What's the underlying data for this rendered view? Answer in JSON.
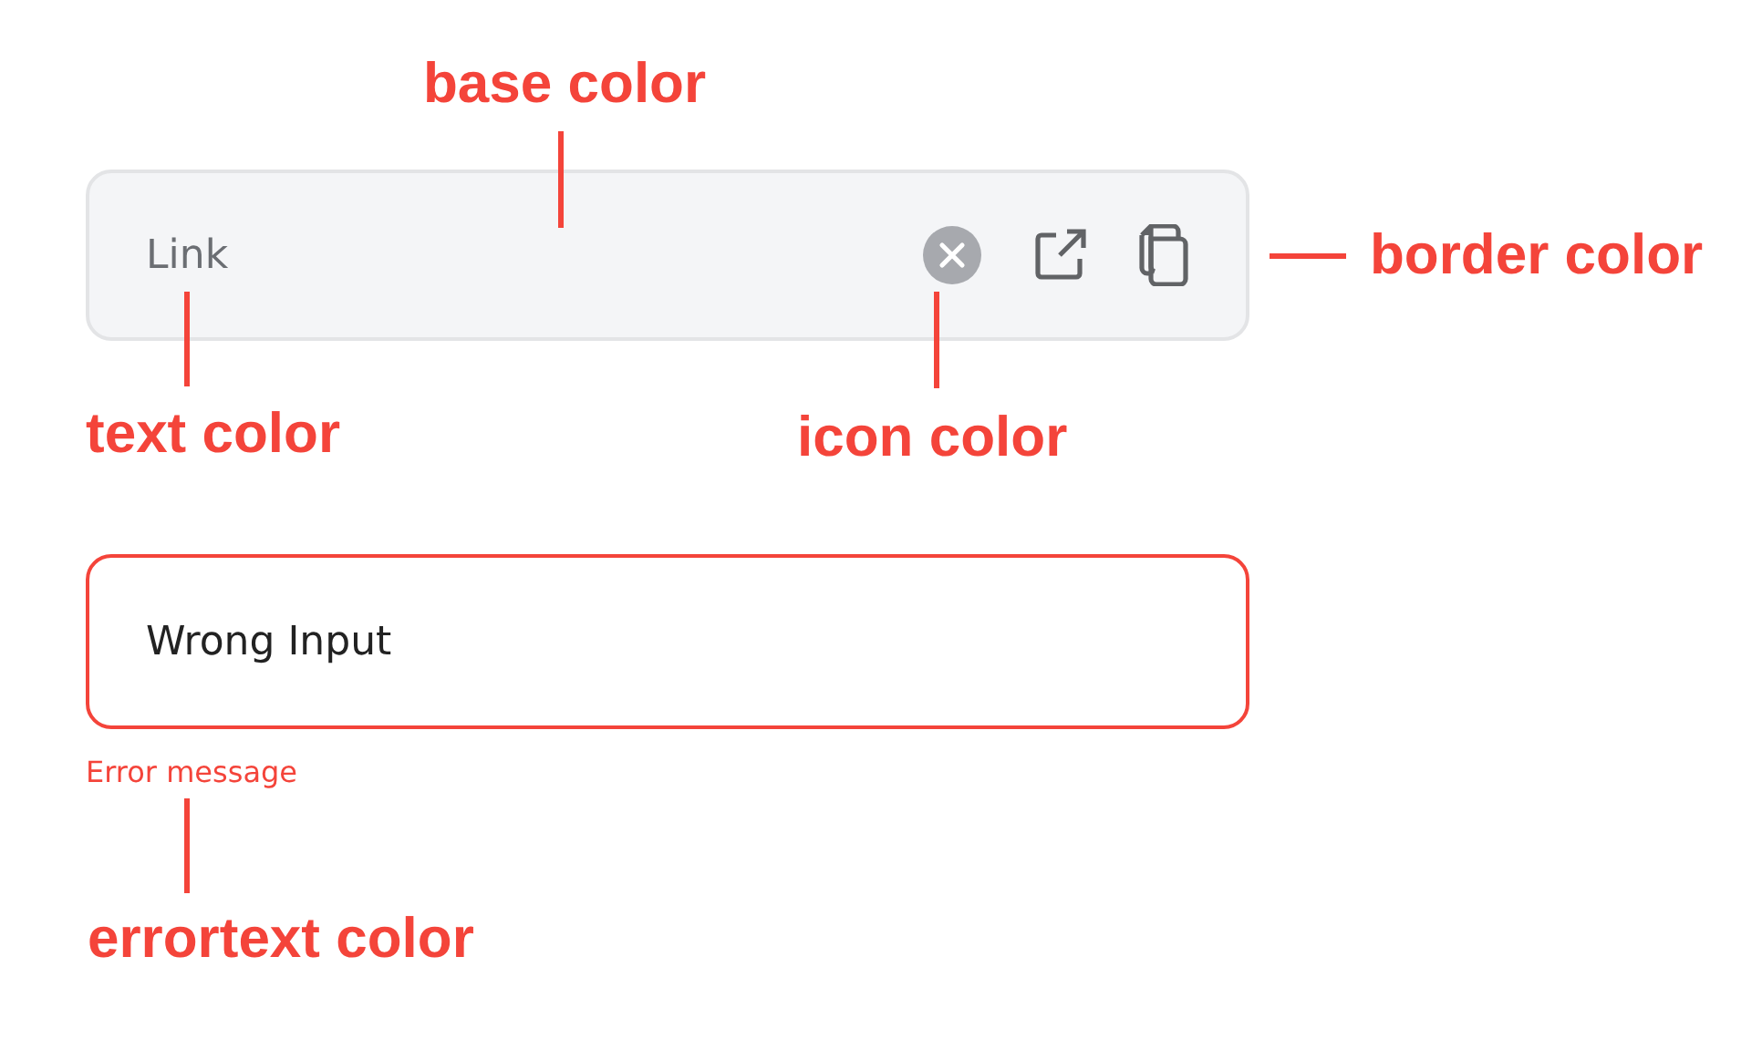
{
  "fields": [
    {
      "kind": "link",
      "value": "Link",
      "error": false
    },
    {
      "kind": "text",
      "value": "Wrong Input",
      "error": true,
      "error_message": "Error message"
    }
  ],
  "annotations": [
    {
      "label": "base color"
    },
    {
      "label": "border color"
    },
    {
      "label": "text color"
    },
    {
      "label": "icon color"
    },
    {
      "label": "errortext color"
    }
  ]
}
